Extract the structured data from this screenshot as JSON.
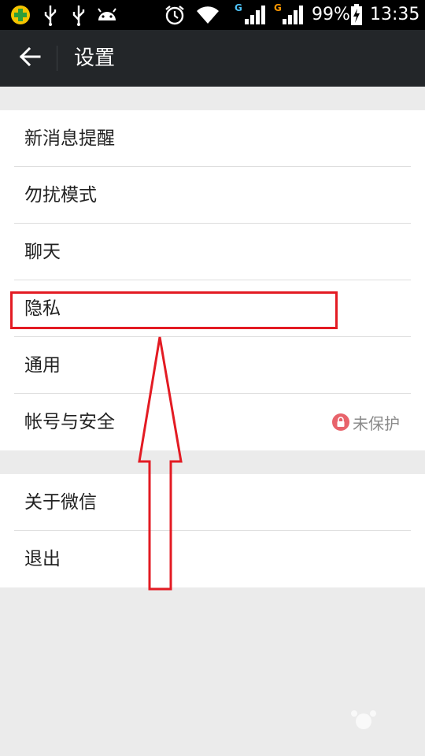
{
  "status_bar": {
    "battery": "99%",
    "time": "13:35",
    "net_1": "G",
    "net_2": "G",
    "icons_left": [
      "shield-plus-icon",
      "usb-icon",
      "usb-icon",
      "android-icon"
    ],
    "icons_right": [
      "alarm-icon",
      "wifi-icon",
      "signal-icon",
      "signal-icon",
      "battery-charging-icon"
    ]
  },
  "toolbar": {
    "title": "设置",
    "back_icon": "arrow-left-icon"
  },
  "settings": {
    "group1": [
      {
        "label": "新消息提醒"
      },
      {
        "label": "勿扰模式"
      },
      {
        "label": "聊天"
      },
      {
        "label": "隐私"
      },
      {
        "label": "通用"
      },
      {
        "label": "帐号与安全",
        "status": "未保护"
      }
    ],
    "group2": [
      {
        "label": "关于微信"
      },
      {
        "label": "退出"
      }
    ]
  },
  "colors": {
    "toolbar_bg": "#232629",
    "page_bg": "#ebebeb",
    "annotation_red": "#e31b23",
    "lock_red": "#e8636b"
  }
}
